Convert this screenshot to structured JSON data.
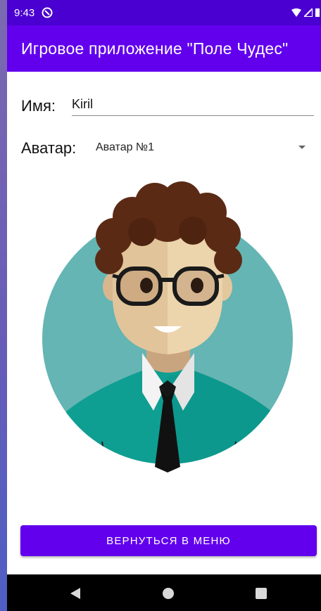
{
  "status_bar": {
    "time": "9:43",
    "icons": [
      "sync-icon",
      "wifi-icon",
      "signal-icon",
      "battery-icon"
    ]
  },
  "app_bar": {
    "title": "Игровое приложение \"Поле Чудес\""
  },
  "form": {
    "name_label": "Имя:",
    "name_value": "Kiril",
    "avatar_label": "Аватар:",
    "avatar_selected": "Аватар №1"
  },
  "avatar_image": {
    "depicts": "cartoon-man-with-curly-hair-and-glasses"
  },
  "actions": {
    "back_button_label": "ВЕРНУТЬСЯ В МЕНЮ"
  },
  "nav_bar": {
    "buttons": [
      "back-icon",
      "home-icon",
      "recents-icon"
    ]
  },
  "colors": {
    "status_bar": "#4a00d0",
    "primary": "#6200ee",
    "avatar_circle": "#64b5b3",
    "shirt": "#0f9e92"
  }
}
